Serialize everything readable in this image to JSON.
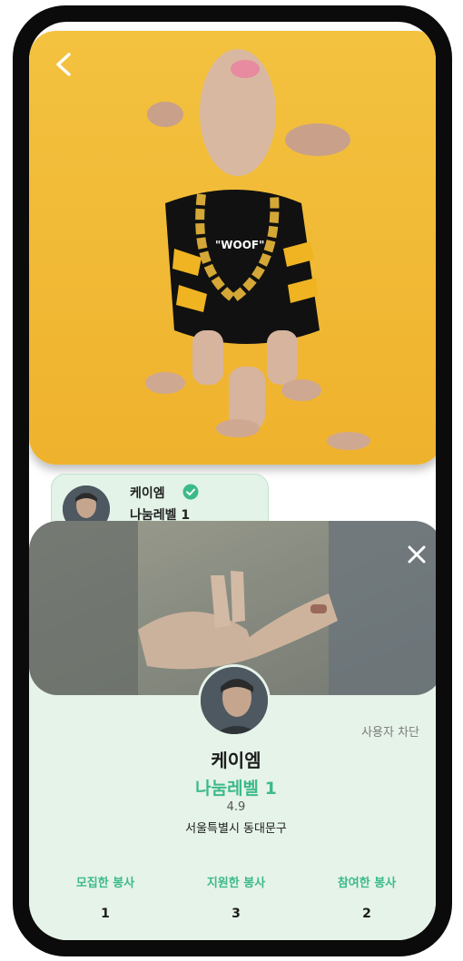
{
  "header": {
    "back_icon": "chevron-left-icon"
  },
  "post_author": {
    "name": "케이엠",
    "level": "나눔레벨 1",
    "verified_icon": "verified-check-icon"
  },
  "profile_modal": {
    "close_icon": "close-icon",
    "block_label": "사용자 차단",
    "name": "케이엠",
    "level": "나눔레벨 1",
    "rating": "4.9",
    "location": "서울특별시 동대문구",
    "stats": [
      {
        "label": "모집한 봉사",
        "value": "1"
      },
      {
        "label": "지원한 봉사",
        "value": "3"
      },
      {
        "label": "참여한 봉사",
        "value": "2"
      }
    ]
  },
  "colors": {
    "accent": "#3cba8a",
    "sheet_bg": "#e6f3e9",
    "hero_bg": "#f3c23f"
  }
}
